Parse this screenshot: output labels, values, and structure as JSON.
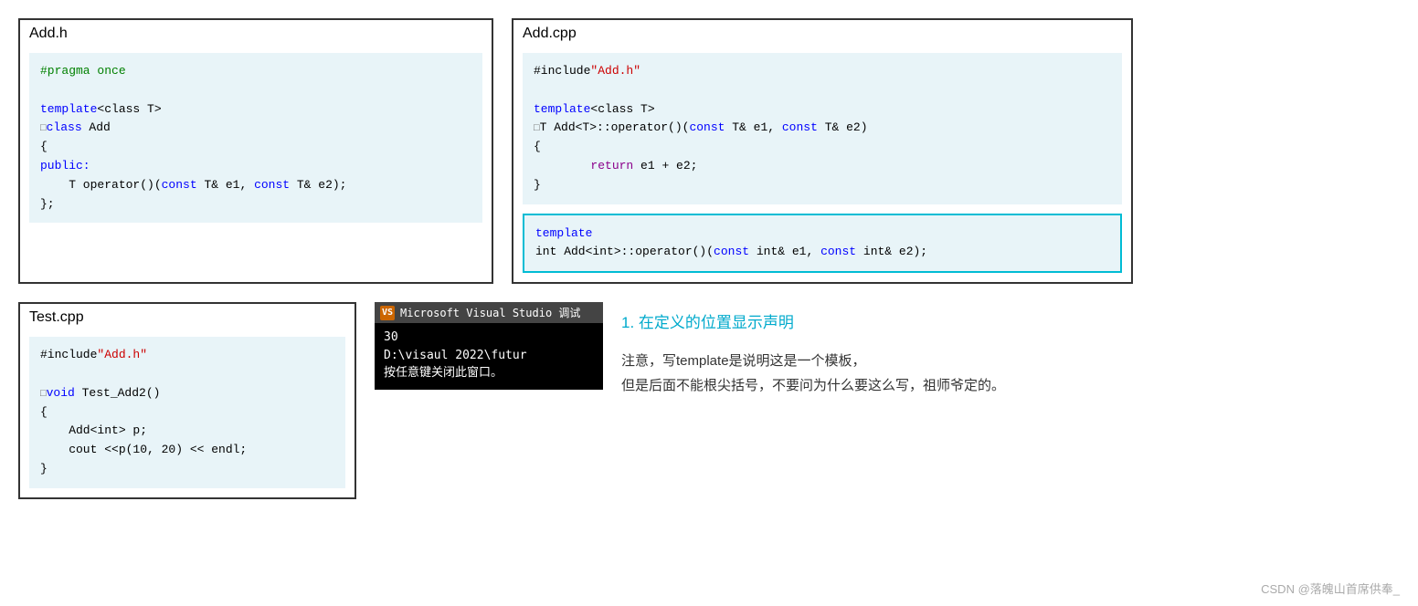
{
  "panels": {
    "add_h": {
      "title": "Add.h",
      "code_lines": [
        {
          "type": "pragma",
          "text": "#pragma once"
        },
        {
          "type": "blank"
        },
        {
          "type": "template",
          "keyword": "template",
          "rest": "<class T>"
        },
        {
          "type": "class_def",
          "minus": "□",
          "keyword": "class",
          "name": " Add"
        },
        {
          "type": "brace_open",
          "text": "{"
        },
        {
          "type": "access",
          "keyword": "public:"
        },
        {
          "type": "method",
          "text": "    T operator()(const T& e1, const T& e2);"
        },
        {
          "type": "brace_close",
          "text": "};"
        }
      ]
    },
    "add_cpp": {
      "title": "Add.cpp",
      "code_lines": [
        {
          "type": "include",
          "text": "#include",
          "str": "\"Add.h\""
        },
        {
          "type": "blank"
        },
        {
          "type": "template",
          "keyword": "template",
          "rest": "<class T>"
        },
        {
          "type": "func_def",
          "minus": "□",
          "ret": "T",
          "name": " Add<T>::operator()(const T& e1, const T& e2)"
        },
        {
          "type": "brace_open",
          "text": "{"
        },
        {
          "type": "return_line",
          "keyword": "return",
          "rest": " e1 + e2;"
        },
        {
          "type": "brace_close",
          "text": "}"
        }
      ],
      "highlighted": {
        "line1": "template",
        "line2": "int Add<int>::operator()(const int& e1, const int& e2);"
      }
    },
    "test_cpp": {
      "title": "Test.cpp",
      "code_lines": [
        {
          "type": "include",
          "text": "#include",
          "str": "\"Add.h\""
        },
        {
          "type": "blank"
        },
        {
          "type": "func_def",
          "minus": "□",
          "keyword": "void",
          "name": " Test_Add2()"
        },
        {
          "type": "brace_open",
          "text": "{"
        },
        {
          "type": "stmt1",
          "text": "    Add<int> p;"
        },
        {
          "type": "stmt2",
          "text": "    cout <<p(10, 20) << endl;"
        },
        {
          "type": "brace_close",
          "text": "}"
        }
      ]
    }
  },
  "annotation": {
    "title": "1. 在定义的位置显示声明",
    "vs_window_title": "Microsoft Visual Studio 调试",
    "vs_output": "30\nD:\\visaul 2022\\futur\n按任意键关闭此窗口。",
    "note_line1": "注意，写template是说明这是一个模板，",
    "note_line2": "但是后面不能根尖括号，不要问为什么要这么写，祖师爷定的。"
  },
  "watermark": "CSDN @落魄山首席供奉_"
}
